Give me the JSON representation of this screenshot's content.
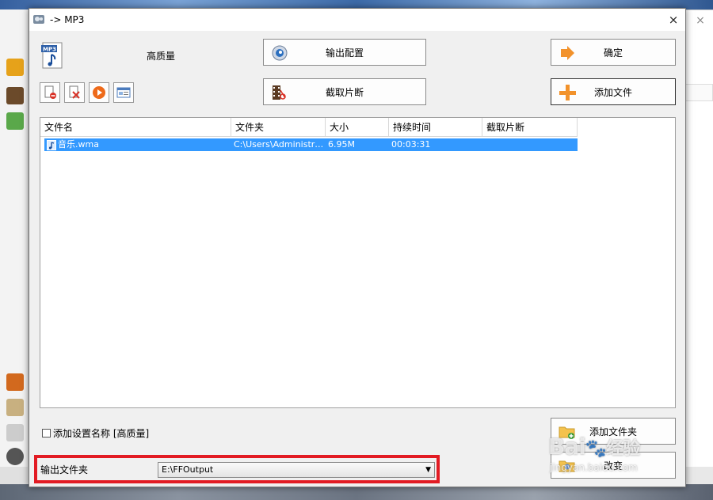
{
  "dialog": {
    "title": "-> MP3",
    "close_glyph": "×",
    "preset_label": "高质量"
  },
  "buttons": {
    "output_config": "输出配置",
    "clip": "截取片断",
    "ok": "确定",
    "add_file": "添加文件",
    "add_folder": "添加文件夹",
    "change": "改变"
  },
  "icons": {
    "toolbar": [
      "delete-doc-icon",
      "remove-icon",
      "play-icon",
      "info-icon"
    ]
  },
  "file_list": {
    "columns": [
      "文件名",
      "文件夹",
      "大小",
      "持续时间",
      "截取片断"
    ],
    "rows": [
      {
        "name": "音乐.wma",
        "folder": "C:\\Users\\Administr…",
        "size": "6.95M",
        "duration": "00:03:31",
        "clip": ""
      }
    ]
  },
  "options": {
    "add_setting_name_label": "添加设置名称 [高质量]",
    "add_setting_name_checked": false
  },
  "output": {
    "label": "输出文件夹",
    "folder_value": "E:\\FFOutput"
  },
  "watermark": {
    "brand": "Bai",
    "brand_suffix": "经验",
    "url": "jingyan.baidu.com"
  },
  "colors": {
    "selection": "#3399ff",
    "highlight_border": "#e21b23"
  }
}
